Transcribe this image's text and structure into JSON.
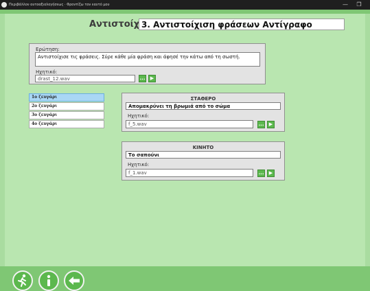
{
  "window": {
    "title": "Περιβάλλον αυτοαξιολογήσεως · Φροντίζω τον εαυτό μου",
    "minimize": "—",
    "restore": "❐"
  },
  "header": {
    "label": "Αντιστοίχιση:",
    "value": "3. Αντιστοίχιση φράσεων Αντίγραφο"
  },
  "question": {
    "label": "Ερώτηση:",
    "text": "Αντιστοίχισε τις φράσεις. Σύρε κάθε μία φράση και άφησέ την κάτω από τη σωστή.",
    "sound_label": "Ηχητικό:",
    "sound_file": "drast_12.wav"
  },
  "pairs": [
    {
      "label": "1ο ζευγάρι",
      "selected": true
    },
    {
      "label": "2ο ζευγάρι",
      "selected": false
    },
    {
      "label": "3ο ζευγάρι",
      "selected": false
    },
    {
      "label": "4ο ζευγάρι",
      "selected": false
    }
  ],
  "fixed": {
    "title": "ΣΤΑΘΕΡΟ",
    "text": "Απομακρύνει τη βρωμιά από το σώμα",
    "sound_label": "Ηχητικό:",
    "sound_file": "f_5.wav"
  },
  "moving": {
    "title": "ΚΙΝΗΤΟ",
    "text": "Το σαπούνι",
    "sound_label": "Ηχητικό:",
    "sound_file": "f_1.wav"
  },
  "buttons": {
    "browse": "...",
    "play": "▶"
  },
  "colors": {
    "background": "#b9e6b0",
    "accent": "#5cb84e",
    "selected": "#a9d7f5"
  },
  "icons": {
    "run": "running-person-icon",
    "info": "info-icon",
    "back": "arrow-left-icon"
  }
}
